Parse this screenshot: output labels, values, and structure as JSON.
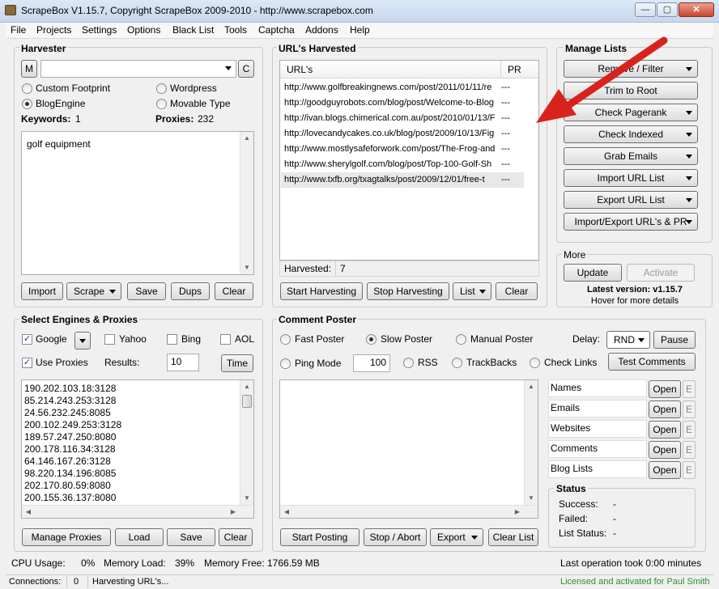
{
  "window": {
    "title": "ScrapeBox V1.15.7, Copyright ScrapeBox 2009-2010 - http://www.scrapebox.com",
    "minimize": "—",
    "maximize": "▢",
    "close": "✕"
  },
  "menu": [
    "File",
    "Projects",
    "Settings",
    "Options",
    "Black List",
    "Tools",
    "Captcha",
    "Addons",
    "Help"
  ],
  "harvester": {
    "title": "Harvester",
    "m_button": "M",
    "c_button": "C",
    "footprint_value": "",
    "options": [
      "Custom Footprint",
      "Wordpress",
      "BlogEngine",
      "Movable Type"
    ],
    "selected": "BlogEngine",
    "keywords_label": "Keywords:",
    "keywords_count": "1",
    "proxies_label": "Proxies:",
    "proxies_count": "232",
    "keywords_text": "golf equipment",
    "buttons": {
      "import": "Import",
      "scrape": "Scrape",
      "save": "Save",
      "dups": "Dups",
      "clear": "Clear"
    }
  },
  "urls": {
    "title": "URL's Harvested",
    "col_url": "URL's",
    "col_pr": "PR",
    "rows": [
      {
        "url": "http://www.golfbreakingnews.com/post/2011/01/11/re",
        "pr": "---"
      },
      {
        "url": "http://goodguyrobots.com/blog/post/Welcome-to-Blog",
        "pr": "---"
      },
      {
        "url": "http://ivan.blogs.chimerical.com.au/post/2010/01/13/F",
        "pr": "---"
      },
      {
        "url": "http://lovecandycakes.co.uk/blog/post/2009/10/13/Fig",
        "pr": "---"
      },
      {
        "url": "http://www.mostlysafeforwork.com/post/The-Frog-and",
        "pr": "---"
      },
      {
        "url": "http://www.sherylgolf.com/blog/post/Top-100-Golf-Sh",
        "pr": "---"
      },
      {
        "url": "http://www.txfb.org/txagtalks/post/2009/12/01/free-t",
        "pr": "---"
      }
    ],
    "harvested_label": "Harvested:",
    "harvested_count": "7",
    "buttons": {
      "start": "Start Harvesting",
      "stop": "Stop Harvesting",
      "list": "List",
      "clear": "Clear"
    }
  },
  "manage": {
    "title": "Manage Lists",
    "buttons": [
      "Remove / Filter",
      "Trim to Root",
      "Check Pagerank",
      "Check Indexed",
      "Grab Emails",
      "Import URL List",
      "Export URL List",
      "Import/Export URL's & PR"
    ],
    "more_title": "More",
    "update": "Update",
    "activate": "Activate",
    "latest": "Latest version: v1.15.7",
    "hover": "Hover for more details"
  },
  "engines": {
    "title": "Select Engines & Proxies",
    "google": "Google",
    "yahoo": "Yahoo",
    "bing": "Bing",
    "aol": "AOL",
    "use_proxies": "Use Proxies",
    "results_label": "Results:",
    "results_value": "10",
    "time": "Time",
    "proxies": [
      "190.202.103.18:3128",
      "85.214.243.253:3128",
      "24.56.232.245:8085",
      "200.102.249.253:3128",
      "189.57.247.250:8080",
      "200.178.116.34:3128",
      "64.146.167.26:3128",
      "98.220.134.196:8085",
      "202.170.80.59:8080",
      "200.155.36.137:8080"
    ],
    "buttons": {
      "manage": "Manage Proxies",
      "load": "Load",
      "save": "Save",
      "clear": "Clear"
    }
  },
  "poster": {
    "title": "Comment Poster",
    "fast": "Fast Poster",
    "slow": "Slow Poster",
    "manual": "Manual Poster",
    "delay_label": "Delay:",
    "delay_value": "RND",
    "pause": "Pause",
    "ping": "Ping Mode",
    "ping_value": "100",
    "rss": "RSS",
    "trackbacks": "TrackBacks",
    "check_links": "Check Links",
    "test": "Test Comments",
    "fields": [
      "Names",
      "Emails",
      "Websites",
      "Comments",
      "Blog Lists"
    ],
    "open": "Open",
    "edit": "E",
    "status_title": "Status",
    "success_label": "Success:",
    "success_value": "-",
    "failed_label": "Failed:",
    "failed_value": "-",
    "liststatus_label": "List Status:",
    "liststatus_value": "-",
    "buttons": {
      "start": "Start Posting",
      "stop": "Stop / Abort",
      "export": "Export",
      "clear": "Clear List"
    }
  },
  "footer": {
    "cpu": "CPU Usage:",
    "cpu_value": "0%",
    "mem": "Memory Load:",
    "mem_value": "39%",
    "free": "Memory Free:",
    "free_value": "1766.59 MB",
    "last_op": "Last operation took 0:00 minutes",
    "connections": "Connections:",
    "connections_value": "0",
    "status": "Harvesting URL's...",
    "license": "Licensed and activated for Paul Smith"
  },
  "colors": {
    "arrow": "#d8231c",
    "license": "#2e8b2e"
  }
}
